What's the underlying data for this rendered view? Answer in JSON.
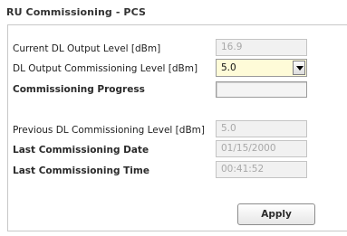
{
  "panel": {
    "title": "RU Commissioning - PCS"
  },
  "fields": {
    "current_dl_output_level": {
      "label": "Current DL Output Level [dBm]",
      "value": "16.9"
    },
    "dl_output_commissioning_level": {
      "label": "DL Output Commissioning Level [dBm]",
      "selected": "5.0"
    },
    "commissioning_progress": {
      "label": "Commissioning Progress",
      "percent": 0
    },
    "previous_dl_commissioning_level": {
      "label": "Previous DL Commissioning Level [dBm]",
      "value": "5.0"
    },
    "last_commissioning_date": {
      "label": "Last Commissioning Date",
      "value": "01/15/2000"
    },
    "last_commissioning_time": {
      "label": "Last Commissioning Time",
      "value": "00:41:52"
    }
  },
  "actions": {
    "apply_label": "Apply"
  },
  "colors": {
    "select_background": "#fefbd8",
    "readonly_background": "#f1f1f1",
    "progress_fill": "#6aa84f"
  }
}
